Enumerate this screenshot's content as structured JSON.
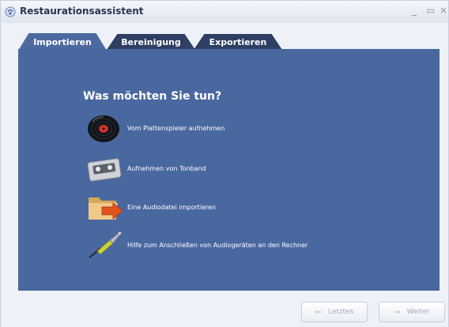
{
  "window": {
    "title": "Restaurationsassistent",
    "icon": "app-icon",
    "controls": {
      "minimize": "_",
      "maximize": "▭",
      "close": "×"
    }
  },
  "tabs": [
    {
      "label": "Importieren",
      "active": true
    },
    {
      "label": "Bereinigung",
      "active": false
    },
    {
      "label": "Exportieren",
      "active": false
    }
  ],
  "main": {
    "heading": "Was möchten Sie tun?",
    "options": [
      {
        "label": "Vom Plattenspieler aufnehmen",
        "icon": "vinyl-record-icon"
      },
      {
        "label": "Aufnehmen von Tonband",
        "icon": "cassette-tape-icon"
      },
      {
        "label": "Eine Audiodatei importieren",
        "icon": "folder-import-icon"
      },
      {
        "label": "Hilfe zum Anschließen von Audiogeräten an den Rechner",
        "icon": "audio-cable-icon"
      }
    ]
  },
  "footer": {
    "back_label": "Letztes",
    "next_label": "Weiter",
    "back_arrow": "⇐",
    "next_arrow": "⇒"
  },
  "colors": {
    "panel": "#4a68a0",
    "tab_active": "#4c6aa0",
    "tab_inactive": "#2e3f63",
    "window_bg": "#eef1f7"
  }
}
